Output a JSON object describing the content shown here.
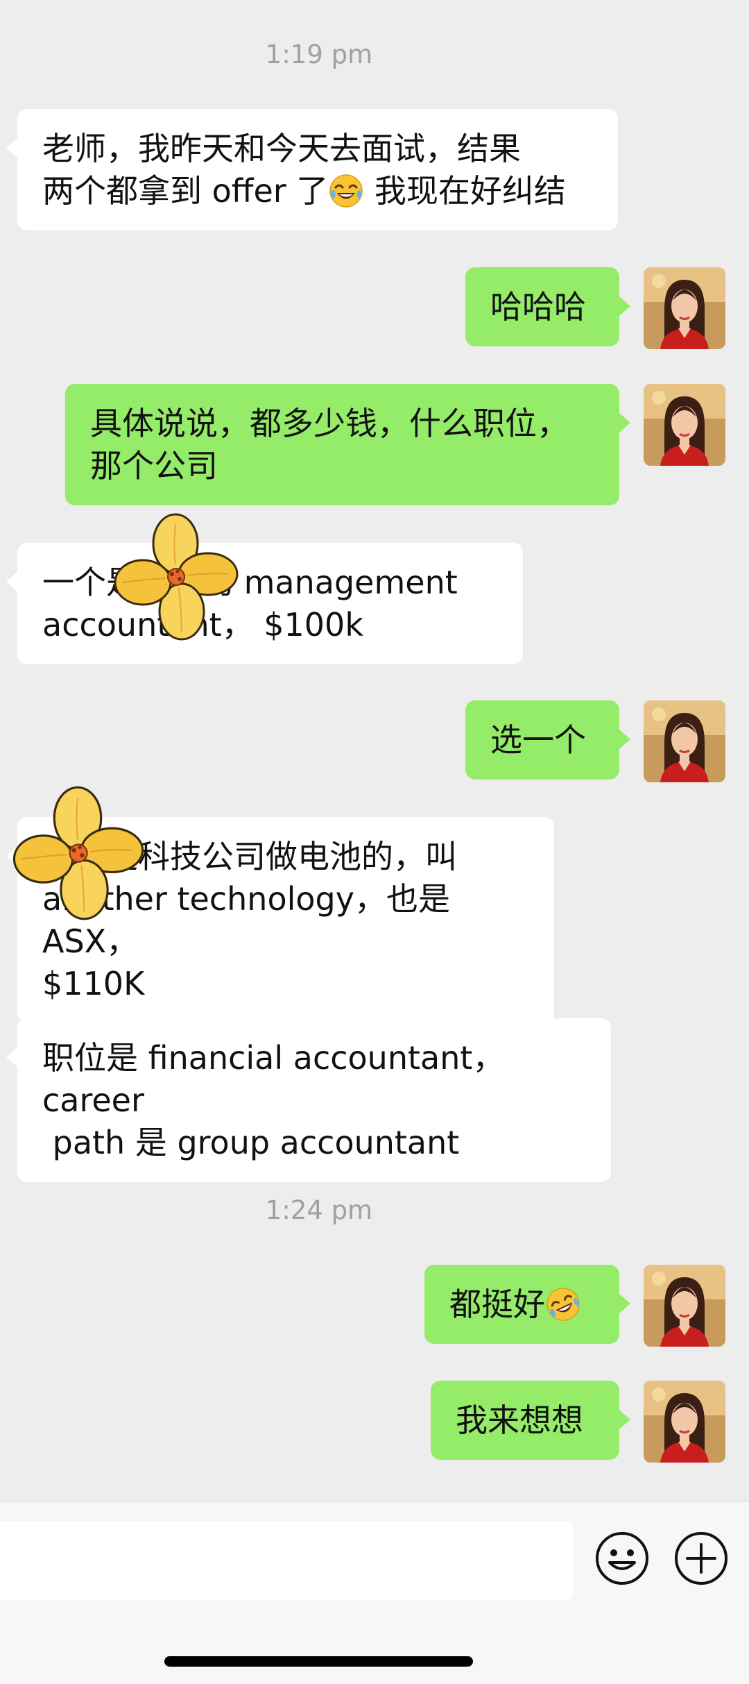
{
  "timestamps": [
    "1:19 pm",
    "1:24 pm"
  ],
  "messages": [
    {
      "side": "left",
      "text": "老师，我昨天和今天去面试，结果\n两个都拿到 offer 了",
      "text_after": " 我现在好纠结",
      "emoji": "tears-of-joy-emoji"
    },
    {
      "side": "right",
      "text": "哈哈哈"
    },
    {
      "side": "right",
      "text": "具体说说，都多少钱，什么职位，\n那个公司"
    },
    {
      "side": "left",
      "text": "一个是上市的 management\naccountant， $100k"
    },
    {
      "side": "right",
      "text": "选一个"
    },
    {
      "side": "left",
      "text": "一个是科技公司做电池的，叫\nanother technology，也是 ASX，\n$110K"
    },
    {
      "side": "left",
      "text": "职位是 financial accountant，career\n path 是 group accountant"
    },
    {
      "side": "right",
      "text": "都挺好",
      "emoji": "rolling-laughing-emoji"
    },
    {
      "side": "right",
      "text": "我来想想"
    }
  ],
  "input": {
    "placeholder": ""
  },
  "icons": {
    "emoji_button": "smiley-face-icon",
    "more_button": "plus-circle-icon",
    "sticker": "yellow-flower-sticker"
  },
  "colors": {
    "background": "#ededed",
    "bubble_self": "#95ec69",
    "bubble_other": "#ffffff",
    "timestamp": "#a0a0a0"
  }
}
